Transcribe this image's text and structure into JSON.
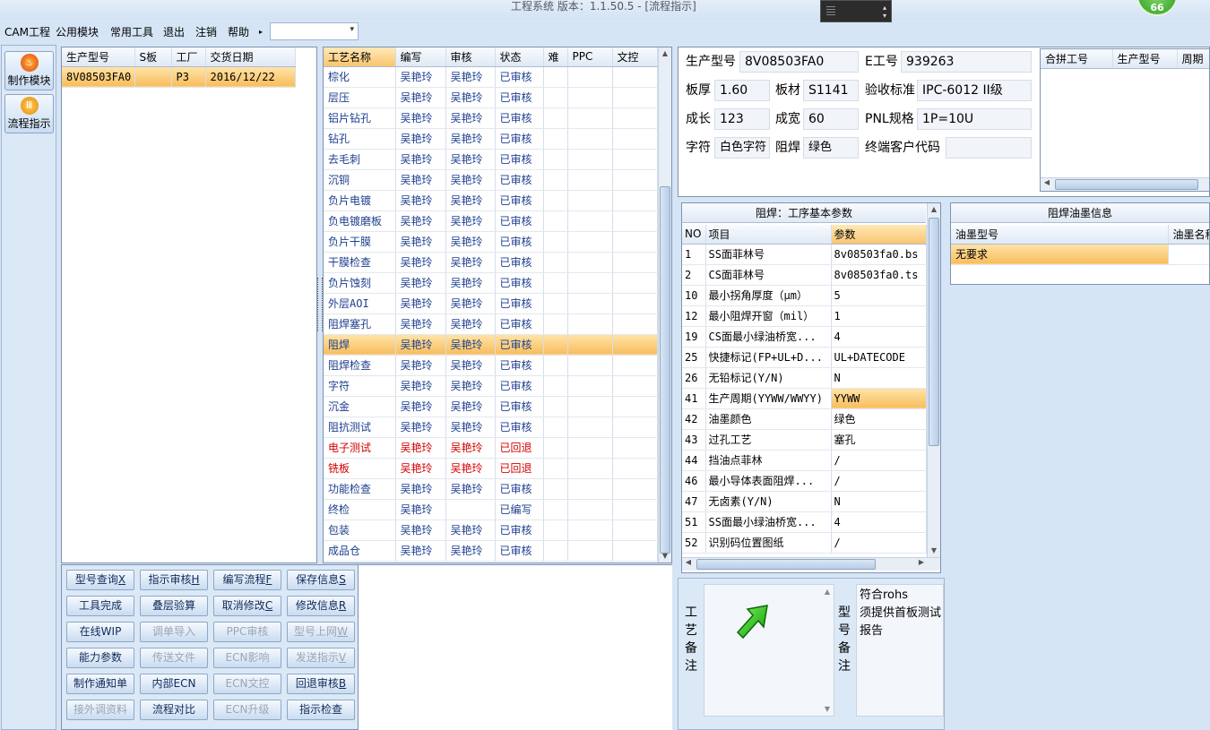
{
  "window": {
    "title": "工程系统   版本：1.1.50.5 - [流程指示]",
    "badge": "66"
  },
  "menu": [
    "CAM工程",
    "公用模块",
    "常用工具",
    "退出",
    "注销",
    "帮助"
  ],
  "menu_dropdown_arrow": "▸",
  "sidebar": [
    {
      "label": "制作模块",
      "icon": "fire-icon"
    },
    {
      "label": "流程指示",
      "icon": "bars-icon"
    }
  ],
  "job_list": {
    "headers": [
      "生产型号",
      "S板",
      "工厂",
      "交货日期"
    ],
    "rows": [
      [
        "8V08503FA0",
        "",
        "P3",
        "2016/12/22"
      ]
    ]
  },
  "process": {
    "headers": [
      "工艺名称",
      "编写",
      "审核",
      "状态",
      "难",
      "PPC",
      "文控"
    ],
    "rows": [
      [
        "棕化",
        "吴艳玲",
        "吴艳玲",
        "已审核"
      ],
      [
        "层压",
        "吴艳玲",
        "吴艳玲",
        "已审核"
      ],
      [
        "铝片钻孔",
        "吴艳玲",
        "吴艳玲",
        "已审核"
      ],
      [
        "钻孔",
        "吴艳玲",
        "吴艳玲",
        "已审核"
      ],
      [
        "去毛刺",
        "吴艳玲",
        "吴艳玲",
        "已审核"
      ],
      [
        "沉铜",
        "吴艳玲",
        "吴艳玲",
        "已审核"
      ],
      [
        "负片电镀",
        "吴艳玲",
        "吴艳玲",
        "已审核"
      ],
      [
        "负电镀磨板",
        "吴艳玲",
        "吴艳玲",
        "已审核"
      ],
      [
        "负片干膜",
        "吴艳玲",
        "吴艳玲",
        "已审核"
      ],
      [
        "干膜检查",
        "吴艳玲",
        "吴艳玲",
        "已审核"
      ],
      [
        "负片蚀刻",
        "吴艳玲",
        "吴艳玲",
        "已审核"
      ],
      [
        "外层AOI",
        "吴艳玲",
        "吴艳玲",
        "已审核"
      ],
      [
        "阻焊塞孔",
        "吴艳玲",
        "吴艳玲",
        "已审核"
      ],
      [
        "阻焊",
        "吴艳玲",
        "吴艳玲",
        "已审核"
      ],
      [
        "阻焊检查",
        "吴艳玲",
        "吴艳玲",
        "已审核"
      ],
      [
        "字符",
        "吴艳玲",
        "吴艳玲",
        "已审核"
      ],
      [
        "沉金",
        "吴艳玲",
        "吴艳玲",
        "已审核"
      ],
      [
        "阻抗测试",
        "吴艳玲",
        "吴艳玲",
        "已审核"
      ],
      [
        "电子测试",
        "吴艳玲",
        "吴艳玲",
        "已回退"
      ],
      [
        "铣板",
        "吴艳玲",
        "吴艳玲",
        "已回退"
      ],
      [
        "功能检查",
        "吴艳玲",
        "吴艳玲",
        "已审核"
      ],
      [
        "终检",
        "吴艳玲",
        "",
        "已编写"
      ],
      [
        "包装",
        "吴艳玲",
        "吴艳玲",
        "已审核"
      ],
      [
        "成品仓",
        "吴艳玲",
        "吴艳玲",
        "已审核"
      ]
    ],
    "selected_index": 13,
    "red_rows": [
      18,
      19
    ]
  },
  "info": {
    "labels": {
      "model": "生产型号",
      "e_no": "E工号",
      "thickness": "板厚",
      "material": "板材",
      "standard": "验收标准",
      "length": "成长",
      "width": "成宽",
      "panel": "PNL规格",
      "char": "字符",
      "mask": "阻焊",
      "end_code": "终端客户代码"
    },
    "values": {
      "model": "8V08503FA0",
      "e_no": "939263",
      "thickness": "1.60",
      "material": "S1141",
      "standard": "IPC-6012 II级",
      "length": "123",
      "width": "60",
      "panel": "1P=10U",
      "char": "白色字符",
      "mask": "绿色",
      "end_code": ""
    }
  },
  "merge": {
    "headers": [
      "合拼工号",
      "生产型号",
      "周期"
    ]
  },
  "params": {
    "title": "阻焊：工序基本参数",
    "headers": [
      "NO",
      "项目",
      "参数"
    ],
    "rows": [
      [
        "1",
        "SS面菲林号",
        "8v08503fa0.bs"
      ],
      [
        "2",
        "CS面菲林号",
        "8v08503fa0.ts"
      ],
      [
        "10",
        "最小拐角厚度（μm）",
        "5"
      ],
      [
        "12",
        "最小阻焊开窗（mil）",
        "1"
      ],
      [
        "19",
        "CS面最小绿油桥宽...",
        "4"
      ],
      [
        "25",
        "快捷标记(FP+UL+D...",
        "UL+DATECODE"
      ],
      [
        "26",
        "无铅标记(Y/N)",
        "N"
      ],
      [
        "41",
        "生产周期(YYWW/WWYY)",
        "YYWW"
      ],
      [
        "42",
        "油墨颜色",
        "绿色"
      ],
      [
        "43",
        "过孔工艺",
        "塞孔"
      ],
      [
        "44",
        "挡油点菲林",
        "/"
      ],
      [
        "46",
        "最小导体表面阻焊...",
        "/"
      ],
      [
        "47",
        "无卤素(Y/N)",
        "N"
      ],
      [
        "51",
        "SS面最小绿油桥宽...",
        "4"
      ],
      [
        "52",
        "识别码位置图纸",
        "/"
      ]
    ],
    "selected_index": 7
  },
  "ink": {
    "title": "阻焊油墨信息",
    "headers": [
      "油墨型号",
      "油墨名称"
    ],
    "rows": [
      [
        "无要求",
        ""
      ]
    ]
  },
  "notes": {
    "process_label": [
      "工",
      "艺",
      "备",
      "注"
    ],
    "model_label": [
      "型",
      "号",
      "备",
      "注"
    ],
    "model_text": "符合rohs\n须提供首板测试报告"
  },
  "actions": [
    [
      {
        "t": "型号查询",
        "k": "X"
      },
      {
        "t": "指示审核",
        "k": "H"
      },
      {
        "t": "编写流程",
        "k": "F"
      },
      {
        "t": "保存信息",
        "k": "S"
      }
    ],
    [
      {
        "t": "工具完成",
        "k": ""
      },
      {
        "t": "叠层验算",
        "k": ""
      },
      {
        "t": "取消修改",
        "k": "C"
      },
      {
        "t": "修改信息",
        "k": "R"
      }
    ],
    [
      {
        "t": "在线WIP",
        "k": ""
      },
      {
        "t": "调单导入",
        "k": "",
        "d": 1
      },
      {
        "t": "PPC审核",
        "k": "",
        "d": 1
      },
      {
        "t": "型号上网",
        "k": "W",
        "d": 1
      }
    ],
    [
      {
        "t": "能力参数",
        "k": ""
      },
      {
        "t": "传送文件",
        "k": "",
        "d": 1
      },
      {
        "t": "ECN影响",
        "k": "",
        "d": 1
      },
      {
        "t": "发送指示",
        "k": "V",
        "d": 1
      }
    ],
    [
      {
        "t": "制作通知单",
        "k": ""
      },
      {
        "t": "内部ECN",
        "k": ""
      },
      {
        "t": "ECN文控",
        "k": "",
        "d": 1
      },
      {
        "t": "回退审核",
        "k": "B"
      }
    ],
    [
      {
        "t": "接外调资料",
        "k": "",
        "d": 1
      },
      {
        "t": "流程对比",
        "k": ""
      },
      {
        "t": "ECN升级",
        "k": "",
        "d": 1
      },
      {
        "t": "指示检查",
        "k": ""
      }
    ]
  ]
}
